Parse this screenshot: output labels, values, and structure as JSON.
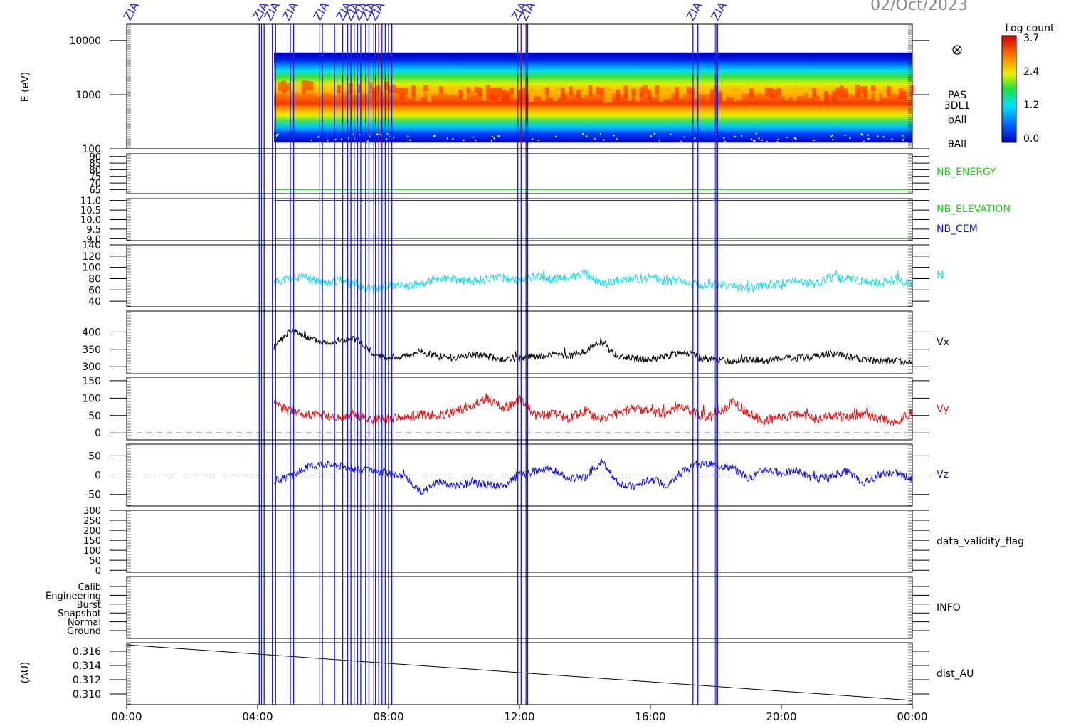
{
  "header": {
    "date": "02/Oct/2023"
  },
  "colors": {
    "n": "#22dde8",
    "vx": "#000000",
    "vy": "#e81010",
    "vz": "#1010dd",
    "nb_energy": "#22cc22",
    "nb_elevation": "#22cc22",
    "nb_cem": "#1010cc",
    "markers": "#1a1add",
    "marker_labels": "#2a2ad0",
    "axes": "#000000"
  },
  "chart_data": [
    {
      "type": "heatmap",
      "ylabel": "E (eV)",
      "y_scale": "log",
      "ylim": [
        100,
        20000
      ],
      "yticks": [
        "10000",
        "1000",
        "100"
      ],
      "right_labels": [
        "PAS",
        "3DL1",
        "φAll",
        "θAll"
      ],
      "colorbar": {
        "title": "Log count",
        "min": 0.0,
        "max": 3.7,
        "ticks": [
          "3.7",
          "2.4",
          "1.2",
          "0.0"
        ]
      },
      "data_time_range": [
        "04:30",
        "24:00"
      ],
      "data_energy_range": [
        130,
        6000
      ],
      "peak_energy_eV": 700
    },
    {
      "type": "line",
      "series": [
        {
          "name": "NB_ENERGY",
          "values": [
            65,
            65
          ]
        }
      ],
      "ylim": [
        62,
        92
      ],
      "yticks": [
        "90",
        "85",
        "80",
        "75",
        "70",
        "65"
      ]
    },
    {
      "type": "line",
      "series": [
        {
          "name": "NB_ELEVATION",
          "values": [
            9,
            9
          ]
        },
        {
          "name": "NB_CEM",
          "values": [
            11,
            11
          ]
        }
      ],
      "ylim": [
        8.9,
        11.1
      ],
      "yticks": [
        "11.0",
        "10.5",
        "10.0",
        "9.5",
        "9.0"
      ]
    },
    {
      "type": "line",
      "series": [
        {
          "name": "N",
          "x": [
            "04:30",
            "05:00",
            "05:30",
            "06:00",
            "06:30",
            "07:00",
            "07:30",
            "08:00",
            "08:30",
            "09:00",
            "09:30",
            "10:00",
            "10:30",
            "11:00",
            "11:30",
            "12:00",
            "12:30",
            "13:00",
            "13:30",
            "14:00",
            "14:30",
            "15:00",
            "15:30",
            "16:00",
            "16:30",
            "17:00",
            "17:30",
            "18:00",
            "18:30",
            "19:00",
            "19:30",
            "20:00",
            "20:30",
            "21:00",
            "21:30",
            "22:00",
            "22:30",
            "23:00",
            "23:30",
            "24:00"
          ],
          "values": [
            75,
            80,
            82,
            72,
            78,
            68,
            62,
            70,
            65,
            72,
            80,
            78,
            75,
            80,
            82,
            75,
            85,
            78,
            82,
            88,
            70,
            78,
            80,
            82,
            75,
            78,
            68,
            70,
            65,
            62,
            68,
            72,
            75,
            70,
            82,
            80,
            75,
            72,
            78,
            70
          ]
        }
      ],
      "ylim": [
        30,
        140
      ],
      "yticks": [
        "140",
        "120",
        "100",
        "80",
        "60",
        "40"
      ]
    },
    {
      "type": "line",
      "series": [
        {
          "name": "Vx",
          "x": [
            "04:30",
            "05:00",
            "05:30",
            "06:00",
            "06:30",
            "07:00",
            "07:30",
            "08:00",
            "08:30",
            "09:00",
            "09:30",
            "10:00",
            "10:30",
            "11:00",
            "11:30",
            "12:00",
            "12:30",
            "13:00",
            "13:30",
            "14:00",
            "14:30",
            "15:00",
            "15:30",
            "16:00",
            "16:30",
            "17:00",
            "17:30",
            "18:00",
            "18:30",
            "19:00",
            "19:30",
            "20:00",
            "20:30",
            "21:00",
            "21:30",
            "22:00",
            "22:30",
            "23:00",
            "23:30",
            "24:00"
          ],
          "values": [
            355,
            405,
            385,
            370,
            375,
            380,
            340,
            325,
            330,
            345,
            330,
            325,
            335,
            330,
            320,
            325,
            330,
            335,
            330,
            345,
            375,
            330,
            325,
            320,
            330,
            345,
            325,
            320,
            315,
            320,
            318,
            322,
            325,
            330,
            340,
            330,
            320,
            315,
            318,
            310
          ]
        }
      ],
      "ylim": [
        280,
        460
      ],
      "yticks": [
        "400",
        "350",
        "300"
      ]
    },
    {
      "type": "line",
      "series": [
        {
          "name": "Vy",
          "x": [
            "04:30",
            "05:00",
            "05:30",
            "06:00",
            "06:30",
            "07:00",
            "07:30",
            "08:00",
            "08:30",
            "09:00",
            "09:30",
            "10:00",
            "10:30",
            "11:00",
            "11:30",
            "12:00",
            "12:30",
            "13:00",
            "13:30",
            "14:00",
            "14:30",
            "15:00",
            "15:30",
            "16:00",
            "16:30",
            "17:00",
            "17:30",
            "18:00",
            "18:30",
            "19:00",
            "19:30",
            "20:00",
            "20:30",
            "21:00",
            "21:30",
            "22:00",
            "22:30",
            "23:00",
            "23:30",
            "24:00"
          ],
          "values": [
            80,
            65,
            55,
            50,
            45,
            50,
            40,
            40,
            45,
            55,
            50,
            60,
            80,
            100,
            70,
            95,
            50,
            55,
            40,
            65,
            40,
            55,
            70,
            60,
            55,
            75,
            50,
            45,
            90,
            55,
            35,
            45,
            55,
            40,
            50,
            45,
            55,
            40,
            30,
            60
          ]
        }
      ],
      "ylim": [
        -20,
        160
      ],
      "yticks": [
        "150",
        "100",
        "50",
        "0"
      ],
      "reference_line": 0
    },
    {
      "type": "line",
      "series": [
        {
          "name": "Vz",
          "x": [
            "04:30",
            "05:00",
            "05:30",
            "06:00",
            "06:30",
            "07:00",
            "07:30",
            "08:00",
            "08:30",
            "09:00",
            "09:30",
            "10:00",
            "10:30",
            "11:00",
            "11:30",
            "12:00",
            "12:30",
            "13:00",
            "13:30",
            "14:00",
            "14:30",
            "15:00",
            "15:30",
            "16:00",
            "16:30",
            "17:00",
            "17:30",
            "18:00",
            "18:30",
            "19:00",
            "19:30",
            "20:00",
            "20:30",
            "21:00",
            "21:30",
            "22:00",
            "22:30",
            "23:00",
            "23:30",
            "24:00"
          ],
          "values": [
            -15,
            -5,
            20,
            30,
            25,
            15,
            10,
            5,
            -5,
            -45,
            -15,
            -30,
            -20,
            -25,
            -30,
            0,
            10,
            15,
            -10,
            -5,
            35,
            -20,
            -30,
            -10,
            -25,
            10,
            30,
            25,
            20,
            -10,
            15,
            5,
            10,
            -10,
            -5,
            10,
            -20,
            0,
            5,
            -10
          ]
        }
      ],
      "ylim": [
        -80,
        80
      ],
      "yticks": [
        "50",
        "0",
        "-50"
      ],
      "reference_line": 0
    },
    {
      "type": "line",
      "series": [
        {
          "name": "data_validity_flag",
          "values": []
        }
      ],
      "ylim": [
        -10,
        300
      ],
      "yticks": [
        "300",
        "250",
        "200",
        "150",
        "100",
        "50",
        "0"
      ]
    },
    {
      "type": "line",
      "series": [
        {
          "name": "INFO",
          "values": []
        }
      ],
      "yticks": [
        "Calib",
        "Engineering",
        "Burst",
        "Snapshot",
        "Normal",
        "Ground"
      ]
    },
    {
      "type": "line",
      "ylabel": "(AU)",
      "series": [
        {
          "name": "dist_AU",
          "x": [
            "00:00",
            "24:00"
          ],
          "values": [
            0.3169,
            0.3091
          ]
        }
      ],
      "ylim": [
        0.3085,
        0.3172
      ],
      "yticks": [
        "0.316",
        "0.314",
        "0.312",
        "0.310"
      ]
    }
  ],
  "x_axis": {
    "ticks": [
      "00:00",
      "04:00",
      "08:00",
      "12:00",
      "16:00",
      "20:00",
      "00:00"
    ],
    "range_hours": [
      0,
      24
    ]
  },
  "markers": {
    "label": "ZIA",
    "times_hours": [
      4.05,
      4.12,
      4.2,
      4.45,
      4.55,
      5.0,
      5.1,
      5.9,
      5.98,
      6.35,
      6.6,
      6.75,
      6.85,
      6.95,
      7.05,
      7.15,
      7.3,
      7.4,
      7.55,
      7.6,
      7.7,
      7.8,
      7.9,
      8.0,
      8.1,
      11.95,
      12.05,
      12.2,
      12.25,
      17.3,
      17.45,
      17.95,
      18.0,
      18.05
    ],
    "label_times_hours": [
      0.1,
      4.05,
      4.4,
      4.95,
      5.9,
      6.6,
      6.85,
      7.1,
      7.35,
      7.6,
      11.95,
      12.2,
      17.3,
      18.05
    ]
  }
}
